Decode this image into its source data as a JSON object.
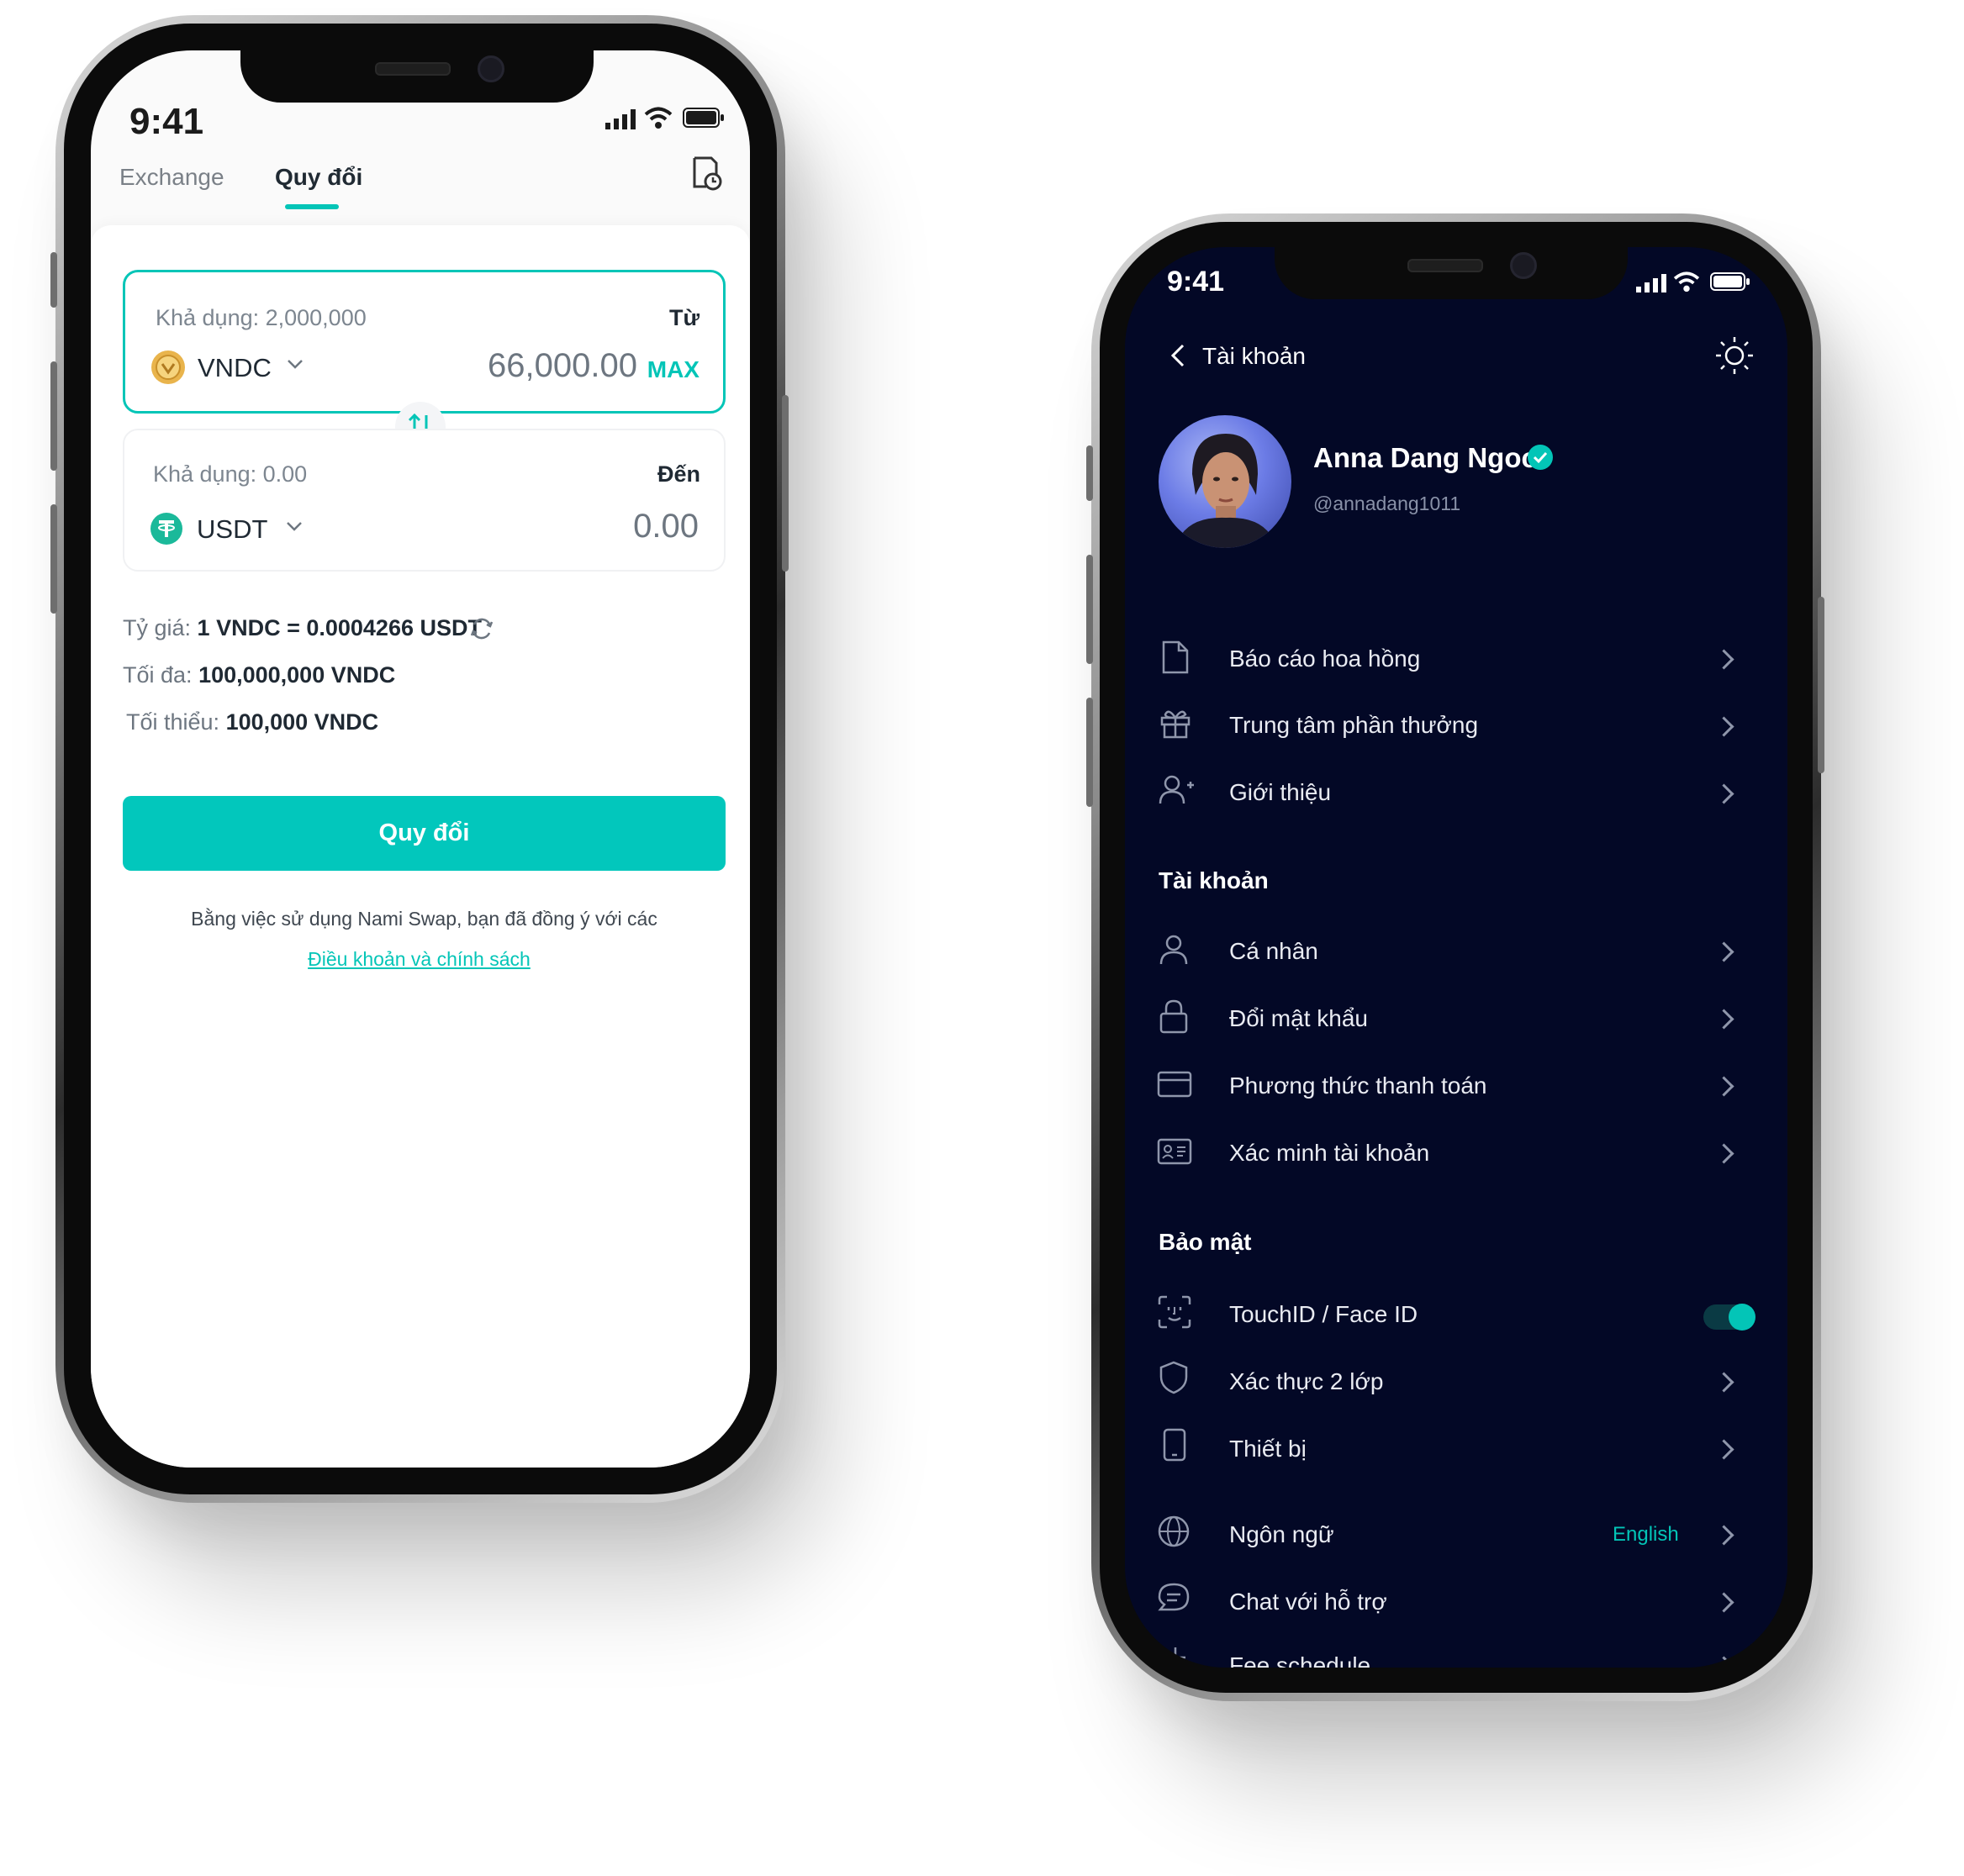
{
  "left_phone": {
    "status": {
      "time": "9:41"
    },
    "tabs": [
      {
        "label": "Exchange",
        "active": false
      },
      {
        "label": "Quy đổi",
        "active": true
      }
    ],
    "from": {
      "available": "Khả dụng: 2,000,000",
      "direction": "Từ",
      "coin": "VNDC",
      "amount": "66,000.00",
      "max_label": "MAX"
    },
    "to": {
      "available": "Khả dụng: 0.00",
      "direction": "Đến",
      "coin": "USDT",
      "amount": "0.00"
    },
    "rate": {
      "label": "Tỷ giá:",
      "value": "1 VNDC = 0.0004266 USDT"
    },
    "max_limit": {
      "label": "Tối đa:",
      "value": "100,000,000 VNDC"
    },
    "min_limit": {
      "label": "Tối thiểu:",
      "value": "100,000 VNDC"
    },
    "cta_label": "Quy đổi",
    "terms_text": "Bằng việc sử dụng Nami Swap, bạn đã đồng ý với các",
    "terms_link": "Điều khoản và chính sách",
    "accent_color": "#03c5b7"
  },
  "right_phone": {
    "status": {
      "time": "9:41"
    },
    "header_title": "Tài khoản",
    "profile": {
      "name": "Anna Dang Ngoc",
      "handle": "@annadang1011",
      "verified": true
    },
    "menu_top": [
      {
        "icon": "document-icon",
        "label": "Báo cáo hoa hồng"
      },
      {
        "icon": "gift-icon",
        "label": "Trung tâm phần thưởng"
      },
      {
        "icon": "user-plus-icon",
        "label": "Giới thiệu"
      }
    ],
    "section_account": "Tài khoản",
    "menu_account": [
      {
        "icon": "user-icon",
        "label": "Cá nhân"
      },
      {
        "icon": "lock-icon",
        "label": "Đổi mật khẩu"
      },
      {
        "icon": "card-icon",
        "label": "Phương thức thanh toán"
      },
      {
        "icon": "id-card-icon",
        "label": "Xác minh tài khoản"
      }
    ],
    "section_security": "Bảo mật",
    "menu_security": [
      {
        "icon": "face-id-icon",
        "label": "TouchID / Face ID",
        "toggle": true
      },
      {
        "icon": "shield-icon",
        "label": "Xác thực 2 lớp"
      },
      {
        "icon": "device-icon",
        "label": "Thiết bị"
      }
    ],
    "menu_bottom": [
      {
        "icon": "globe-icon",
        "label": "Ngôn ngữ",
        "value": "English"
      },
      {
        "icon": "chat-icon",
        "label": "Chat với hỗ trợ"
      },
      {
        "icon": "plus-icon",
        "label": "Fee schedule"
      }
    ],
    "background_color": "#030826",
    "accent_color": "#03c5b7"
  }
}
